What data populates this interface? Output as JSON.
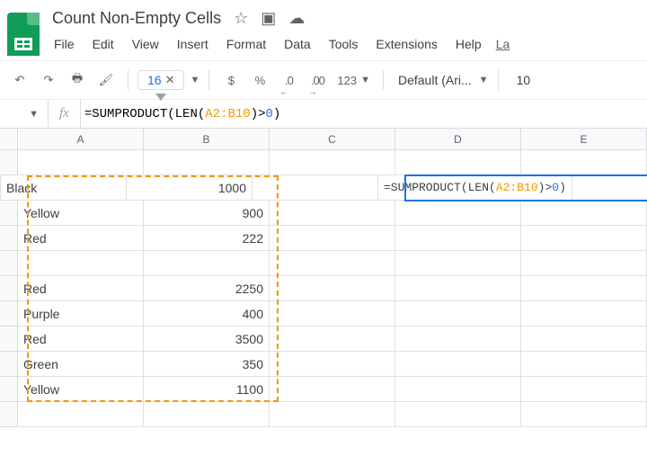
{
  "title": "Count Non-Empty Cells",
  "menu": {
    "file": "File",
    "edit": "Edit",
    "view": "View",
    "insert": "Insert",
    "format": "Format",
    "data": "Data",
    "tools": "Tools",
    "extensions": "Extensions",
    "help": "Help",
    "last_edit": "La"
  },
  "toolbar": {
    "zoom_value": "16",
    "currency": "$",
    "percent": "%",
    "dec_decrease": ".0",
    "dec_increase": ".00",
    "num_format": "123",
    "font_name": "Default (Ari...",
    "font_size": "10"
  },
  "formula_bar": {
    "prefix": "=",
    "fn1": "SUMPRODUCT",
    "paren_open1": "(",
    "fn2": "LEN",
    "paren_open2": "(",
    "ref": "A2:B10",
    "paren_close1": ")>",
    "num": "0",
    "paren_close2": ")"
  },
  "columns": [
    "A",
    "B",
    "C",
    "D",
    "E"
  ],
  "rows": [
    {
      "a": "",
      "b": ""
    },
    {
      "a": "Black",
      "b": "1000"
    },
    {
      "a": "Yellow",
      "b": "900"
    },
    {
      "a": "Red",
      "b": "222"
    },
    {
      "a": "",
      "b": ""
    },
    {
      "a": "Red",
      "b": "2250"
    },
    {
      "a": "Purple",
      "b": "400"
    },
    {
      "a": "Red",
      "b": "3500"
    },
    {
      "a": "Green",
      "b": "350"
    },
    {
      "a": "Yellow",
      "b": "1100"
    }
  ],
  "active_cell_formula": {
    "prefix": "=SUMPRODUCT(LEN(",
    "ref": "A2:B10",
    "mid": ")>",
    "num": "0",
    "suffix": ")"
  }
}
